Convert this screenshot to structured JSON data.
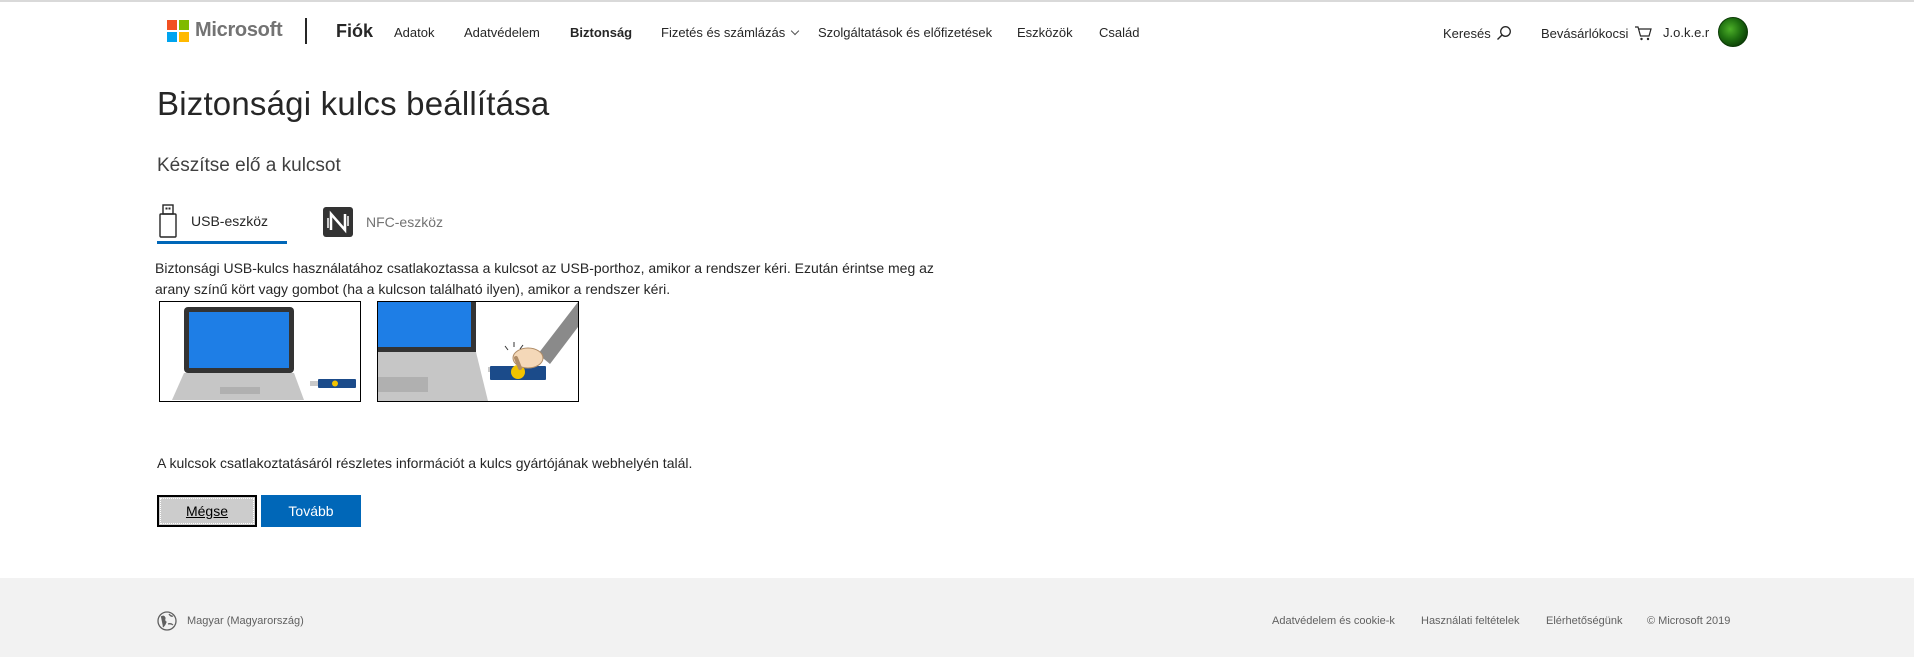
{
  "header": {
    "logo_text": "Microsoft",
    "brand": "Fiók",
    "nav": [
      {
        "label": "Adatok"
      },
      {
        "label": "Adatvédelem"
      },
      {
        "label": "Biztonság"
      },
      {
        "label": "Fizetés és számlázás"
      },
      {
        "label": "Szolgáltatások és előfizetések"
      },
      {
        "label": "Eszközök"
      },
      {
        "label": "Család"
      }
    ],
    "active_nav": "Biztonság",
    "search_label": "Keresés",
    "cart_label": "Bevásárlókocsi",
    "user_name": "J.o.k.e.r"
  },
  "main": {
    "title": "Biztonsági kulcs beállítása",
    "subtitle": "Készítse elő a kulcsot",
    "tabs": [
      {
        "label": "USB-eszköz",
        "icon": "usb-icon",
        "selected": true
      },
      {
        "label": "NFC-eszköz",
        "icon": "nfc-icon",
        "selected": false
      }
    ],
    "description": "Biztonsági USB-kulcs használatához csatlakoztassa a kulcsot az USB-porthoz, amikor a rendszer kéri. Ezután érintse meg az arany színű kört vagy gombot (ha a kulcson található ilyen), amikor a rendszer kéri.",
    "info": "A kulcsok csatlakoztatásáról részletes információt a kulcs gyártójának webhelyén talál.",
    "cancel_button": "Mégse",
    "next_button": "Tovább"
  },
  "footer": {
    "locale": "Magyar (Magyarország)",
    "links": [
      {
        "label": "Adatvédelem és cookie-k"
      },
      {
        "label": "Használati feltételek"
      },
      {
        "label": "Elérhetőségünk"
      },
      {
        "label": "© Microsoft 2019"
      }
    ]
  },
  "colors": {
    "accent": "#0067b8",
    "ms_red": "#f25022",
    "ms_green": "#7fba00",
    "ms_blue": "#00a4ef",
    "ms_yellow": "#ffb900"
  }
}
